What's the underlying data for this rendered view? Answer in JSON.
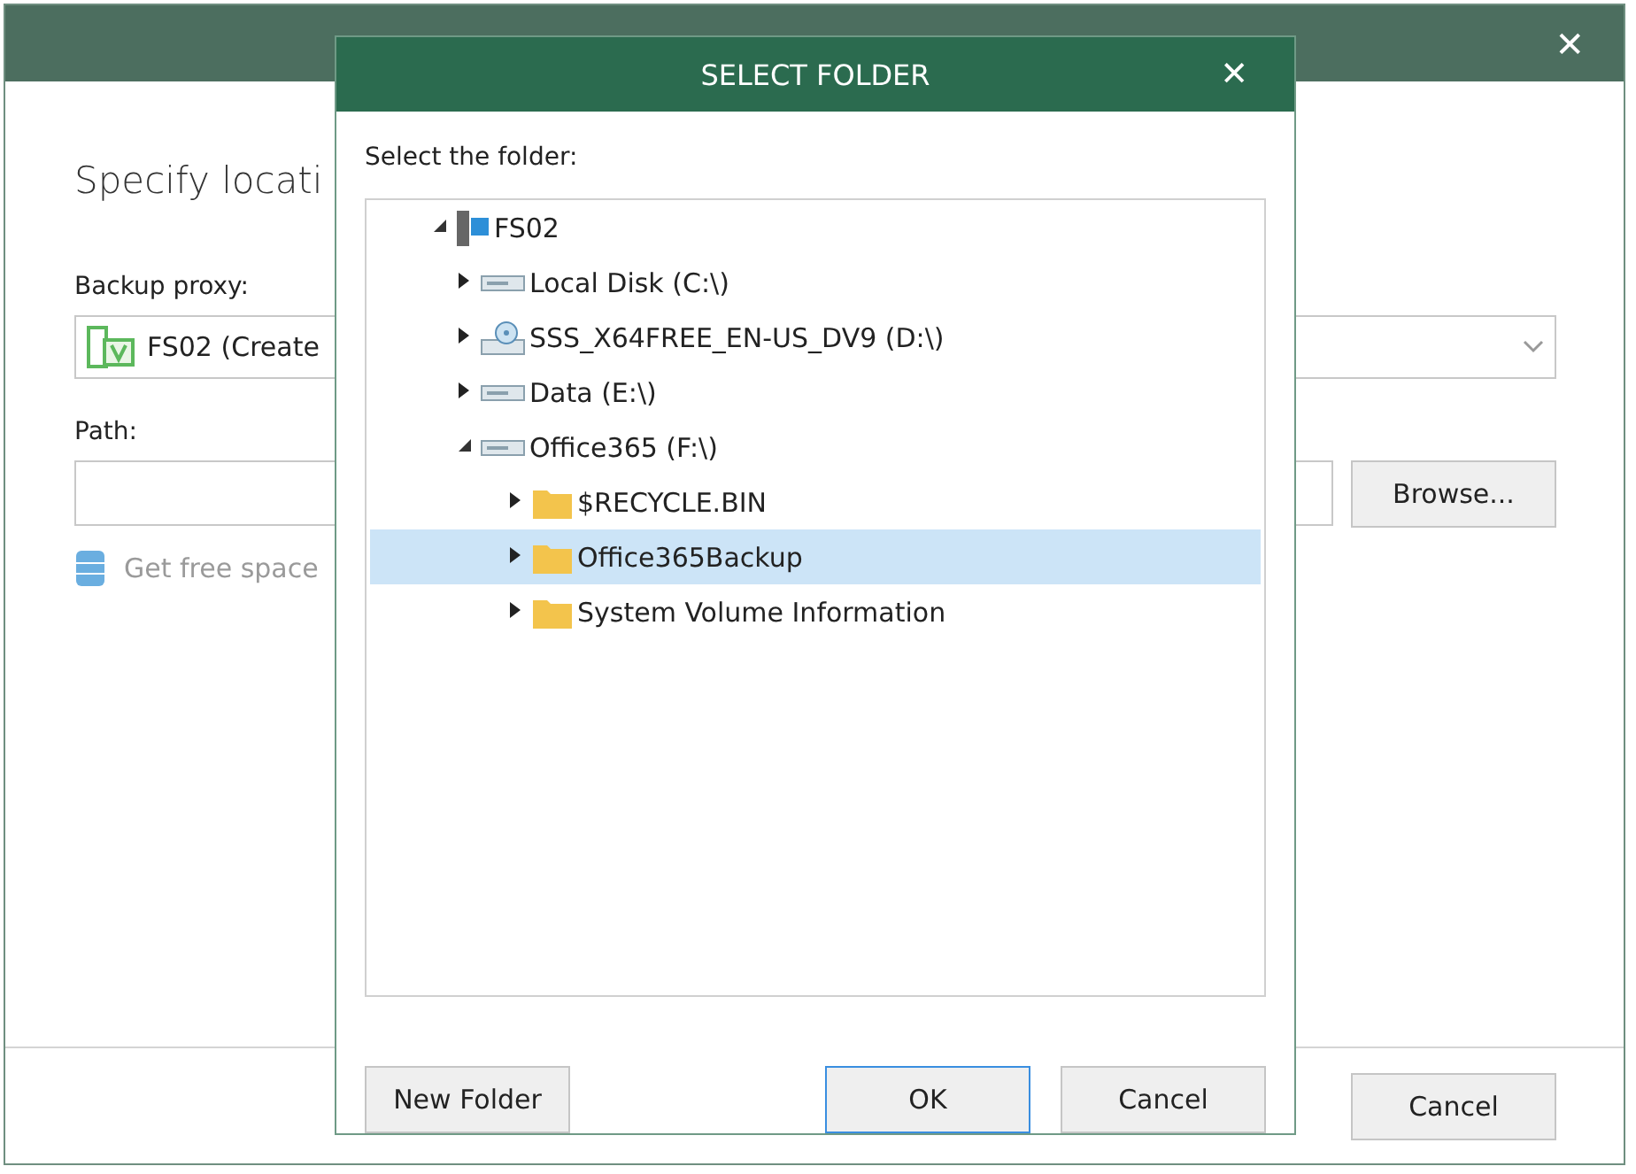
{
  "main_window": {
    "close": "✕",
    "heading": "Specify locati",
    "proxy_label": "Backup proxy:",
    "proxy_value": "FS02 (Create",
    "path_label": "Path:",
    "browse": "Browse...",
    "free_space": "Get free space",
    "cancel": "Cancel"
  },
  "dialog": {
    "title": "SELECT FOLDER",
    "close": "✕",
    "prompt": "Select the folder:",
    "tree": [
      {
        "label": "FS02",
        "kind": "computer",
        "expanded": true,
        "selected": false,
        "children": [
          {
            "label": "Local Disk (C:\\)",
            "kind": "drive",
            "expanded": false,
            "selected": false
          },
          {
            "label": "SSS_X64FREE_EN-US_DV9 (D:\\)",
            "kind": "disc",
            "expanded": false,
            "selected": false
          },
          {
            "label": "Data (E:\\)",
            "kind": "drive",
            "expanded": false,
            "selected": false
          },
          {
            "label": "Office365 (F:\\)",
            "kind": "drive",
            "expanded": true,
            "selected": false,
            "children": [
              {
                "label": "$RECYCLE.BIN",
                "kind": "folder",
                "expanded": false,
                "selected": false
              },
              {
                "label": "Office365Backup",
                "kind": "folder",
                "expanded": false,
                "selected": true
              },
              {
                "label": "System Volume Information",
                "kind": "folder",
                "expanded": false,
                "selected": false
              }
            ]
          }
        ]
      }
    ],
    "buttons": [
      {
        "label": "New Folder",
        "kind": "left",
        "selected": false
      },
      {
        "label": "OK",
        "kind": "right",
        "selected": true
      },
      {
        "label": "Cancel",
        "kind": "right",
        "selected": false
      }
    ]
  }
}
